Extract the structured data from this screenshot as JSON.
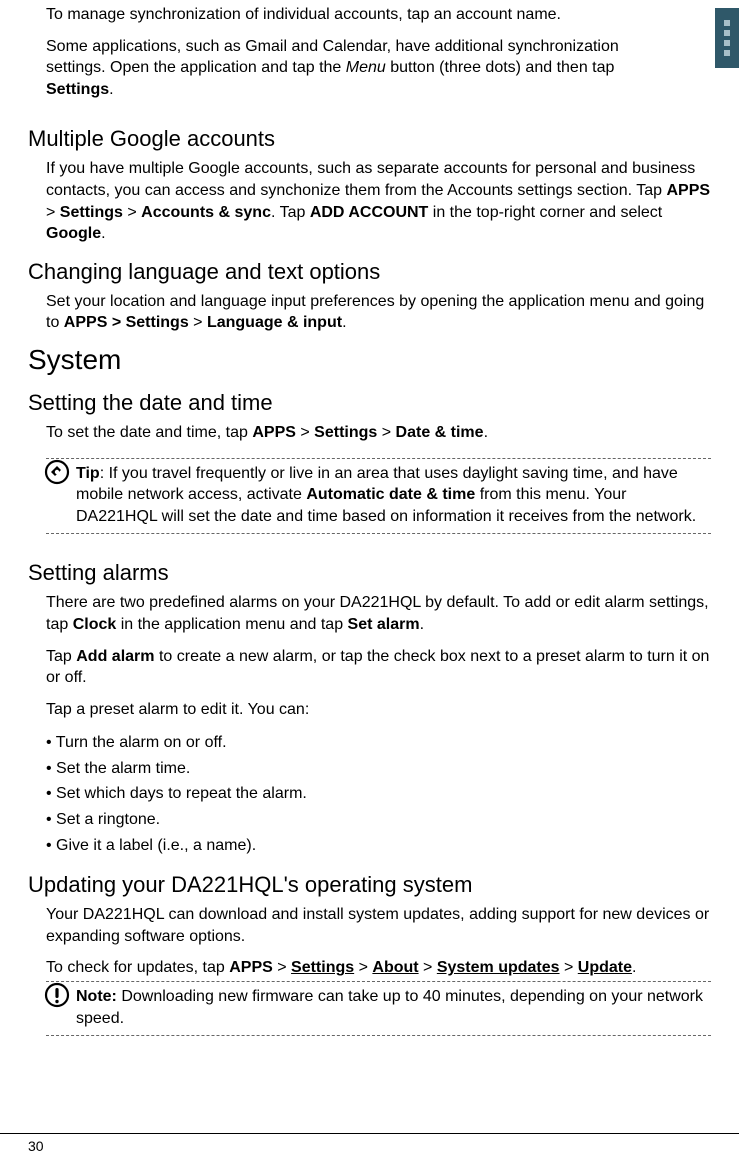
{
  "intro": {
    "p1": "To manage synchronization of individual accounts, tap an account name.",
    "p2a": "Some applications, such as Gmail and Calendar, have additional synchronization settings. Open the application and tap the ",
    "p2_menu": "Menu",
    "p2b": " button (three dots) and then tap ",
    "p2_settings": "Settings",
    "p2c": "."
  },
  "multi": {
    "h": "Multiple Google accounts",
    "p1a": "If you have multiple Google accounts, such as separate accounts for personal and business contacts, you can access and synchonize them from the Accounts settings section. Tap ",
    "apps": "APPS",
    "gt1": " > ",
    "settings": "Settings",
    "gt2": " > ",
    "acctsync": "Accounts & sync",
    "p1b": ". Tap ",
    "add": "ADD ACCOUNT",
    "p1c": " in the top-right corner and select ",
    "google": "Google",
    "p1d": "."
  },
  "lang": {
    "h": "Changing language and text options",
    "p1a": "Set your location and language input preferences by opening the application menu and going to ",
    "path1": "APPS > Settings",
    "gt": " > ",
    "path2": "Language & input",
    "p1b": "."
  },
  "system": {
    "h": "System"
  },
  "datetime": {
    "h": "Setting the date and time",
    "p1a": "To set the date and time, tap ",
    "apps": "APPS",
    "gt1": " > ",
    "settings": "Settings",
    "gt2": " > ",
    "dt": "Date & time",
    "p1b": "."
  },
  "tip": {
    "label": "Tip",
    "sep": ": ",
    "texta": "If you travel frequently or live in an area that uses daylight saving time, and have mobile network access, activate ",
    "auto": "Automatic date & time",
    "textb": " from this menu. Your DA221HQL will set the date and time based on information it receives from the network."
  },
  "alarms": {
    "h": "Setting alarms",
    "p1a": "There are two predefined alarms on your DA221HQL by default. To add or edit alarm settings, tap ",
    "clock": "Clock",
    "p1b": " in the application menu and tap ",
    "setalarm": "Set alarm",
    "p1c": ".",
    "p2a": "Tap ",
    "addalarm": "Add alarm",
    "p2b": " to create a new alarm, or tap the check box next to a preset alarm to turn it on or off.",
    "p3": "Tap a preset alarm to edit it. You can:",
    "b1": "• Turn the alarm on or off.",
    "b2": "• Set the alarm time.",
    "b3": "• Set which days to repeat the alarm.",
    "b4": "• Set a ringtone.",
    "b5": "• Give it a label (i.e., a name)."
  },
  "update": {
    "h": "Updating your DA221HQL's operating system",
    "p1": "Your DA221HQL can download and install system updates, adding support for new devices or expanding software options.",
    "p2a": "To check for updates, tap ",
    "apps": "APPS",
    "gt1": " > ",
    "settings": "Settings",
    "gt2": " > ",
    "about": "About",
    "gt3": " > ",
    "sysup": "System updates",
    "gt4": " > ",
    "upd": "Update",
    "p2b": "."
  },
  "note": {
    "label": "Note:",
    "text": " Downloading new firmware can take up to 40 minutes, depending on your network speed."
  },
  "pagenum": "30"
}
